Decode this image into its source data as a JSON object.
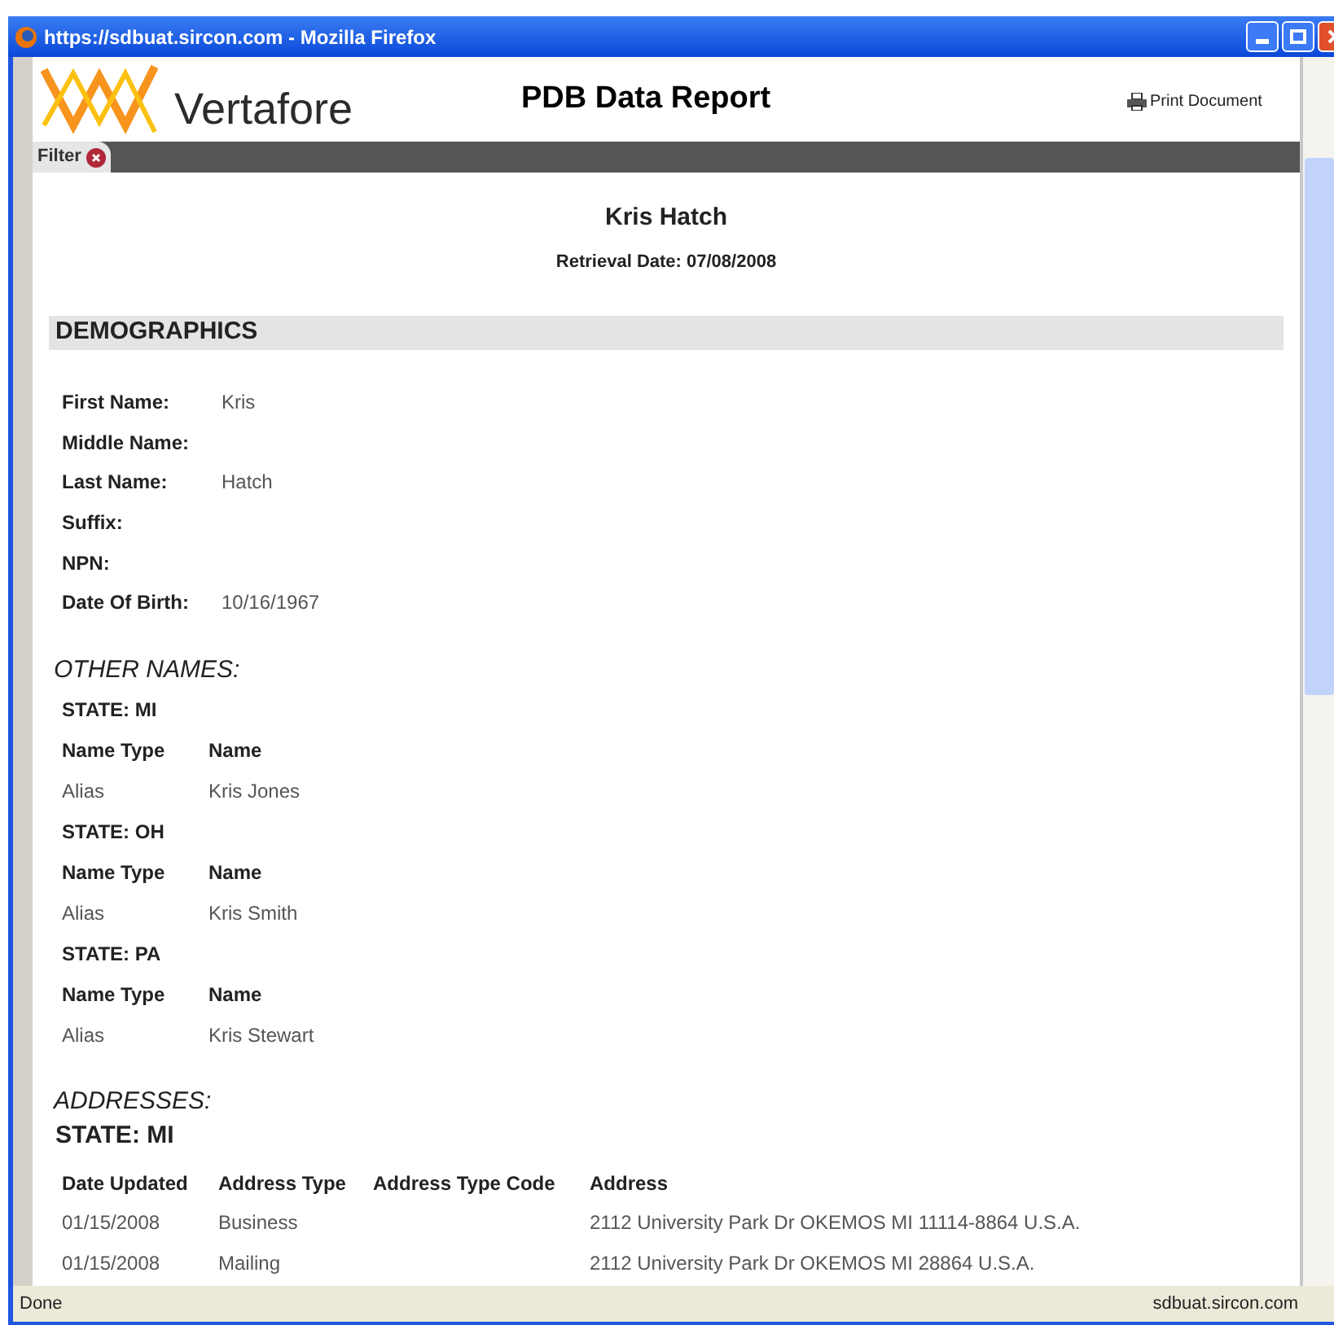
{
  "window": {
    "title": "https://sdbuat.sircon.com - Mozilla Firefox"
  },
  "header": {
    "logo_text": "Vertafore",
    "title": "PDB Data Report",
    "print_link": "Print Document"
  },
  "filter": {
    "label": "Filter"
  },
  "report": {
    "name": "Kris Hatch",
    "retrieval": "Retrieval Date: 07/08/2008"
  },
  "demographics": {
    "heading": "DEMOGRAPHICS",
    "fields": [
      {
        "label": "First Name:",
        "value": "Kris"
      },
      {
        "label": "Middle Name:"
      },
      {
        "label": "Last Name:",
        "value": "Hatch"
      },
      {
        "label": "Suffix:"
      },
      {
        "label": "NPN:"
      },
      {
        "label": "Date Of Birth:",
        "value": "10/16/1967"
      }
    ]
  },
  "other_names": {
    "heading": "OTHER NAMES:",
    "groups": [
      {
        "state": "STATE: MI",
        "columns": [
          "Name Type",
          "Name"
        ],
        "rows": [
          [
            "Alias",
            "Kris Jones"
          ]
        ]
      },
      {
        "state": "STATE: OH",
        "columns": [
          "Name Type",
          "Name"
        ],
        "rows": [
          [
            "Alias",
            "Kris Smith"
          ]
        ]
      },
      {
        "state": "STATE: PA",
        "columns": [
          "Name Type",
          "Name"
        ],
        "rows": [
          [
            "Alias",
            "Kris Stewart"
          ]
        ]
      }
    ]
  },
  "addresses": {
    "heading": "ADDRESSES:",
    "groups": [
      {
        "state": "STATE: MI",
        "columns": [
          "Date Updated",
          "Address Type",
          "Address Type Code",
          "Address"
        ],
        "rows": [
          [
            "01/15/2008",
            "Business",
            "",
            "2112 University Park Dr OKEMOS MI 11114-8864 U.S.A."
          ],
          [
            "01/15/2008",
            "Mailing",
            "",
            "2112 University Park Dr OKEMOS MI 28864 U.S.A."
          ]
        ]
      }
    ]
  },
  "status_bar": {
    "text": "Done",
    "host": "sdbuat.sircon.com"
  }
}
